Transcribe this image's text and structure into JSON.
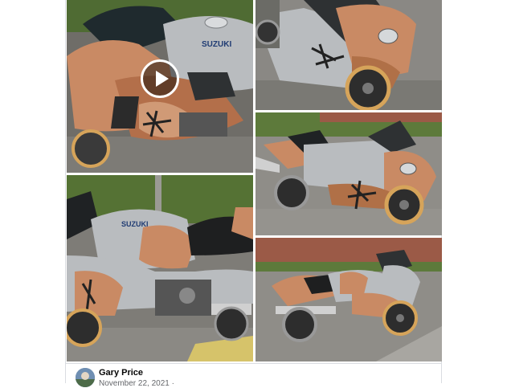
{
  "post": {
    "author_name": "Gary Price",
    "date_text": "November 22, 2021 · ",
    "media": [
      {
        "kind": "video",
        "subject": "Suzuki Hayabusa tank close-up",
        "has_play_button": true,
        "tank_text": "SUZUKI"
      },
      {
        "kind": "photo",
        "subject": "Front fairing and wheel",
        "has_play_button": false
      },
      {
        "kind": "photo",
        "subject": "Right side view",
        "has_play_button": false
      },
      {
        "kind": "photo",
        "subject": "Left side tank and seat",
        "has_play_button": false,
        "tank_text": "SUZUKI"
      },
      {
        "kind": "photo",
        "subject": "Full left side view near fence",
        "has_play_button": false
      }
    ]
  },
  "colors": {
    "copper": "#c98a64",
    "silver": "#b9bcbf",
    "tarmac": "#8e8c87",
    "grass": "#5d7a3b",
    "fence": "#9b5a47",
    "border": "#dadde1"
  },
  "icons": {
    "play": "play-icon",
    "avatar": "avatar"
  }
}
